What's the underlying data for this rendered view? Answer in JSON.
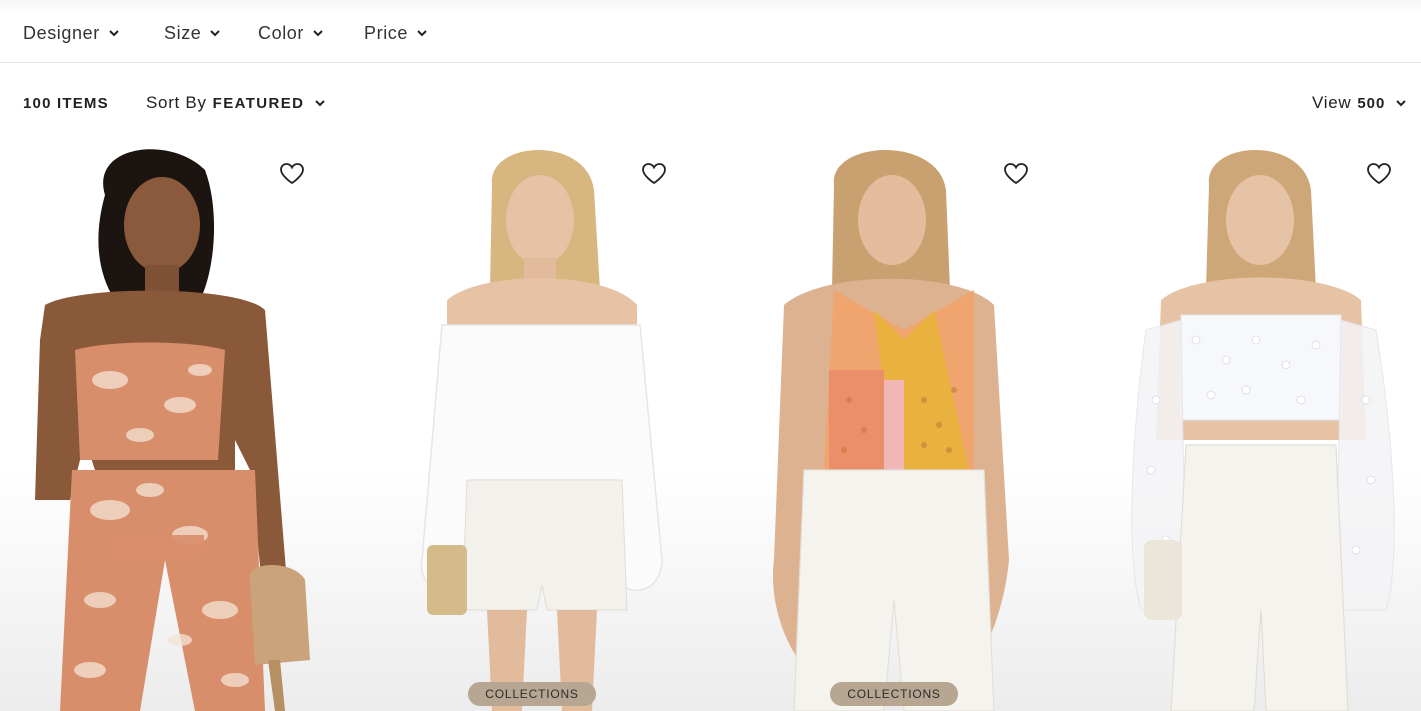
{
  "filters": {
    "designer": "Designer",
    "size": "Size",
    "color": "Color",
    "price": "Price"
  },
  "toolbar": {
    "item_count": "100 ITEMS",
    "sort_prefix": "Sort By",
    "sort_value": "FEATURED",
    "view_prefix": "View",
    "view_value": "500"
  },
  "products": [
    {
      "outfit": "floral strapless top and pants",
      "accent": "#d98e6b",
      "badge": ""
    },
    {
      "outfit": "white off-shoulder blouse and shorts",
      "accent": "#ffffff",
      "badge": "COLLECTIONS"
    },
    {
      "outfit": "patchwork halter scarf top and white trousers",
      "accent": "#e9b23f",
      "badge": "COLLECTIONS"
    },
    {
      "outfit": "sheer polka dot off-shoulder top and white trousers",
      "accent": "#f4f4f4",
      "badge": ""
    }
  ],
  "icons": {
    "wishlist": "heart-outline-icon",
    "dropdown": "chevron-down-icon"
  }
}
